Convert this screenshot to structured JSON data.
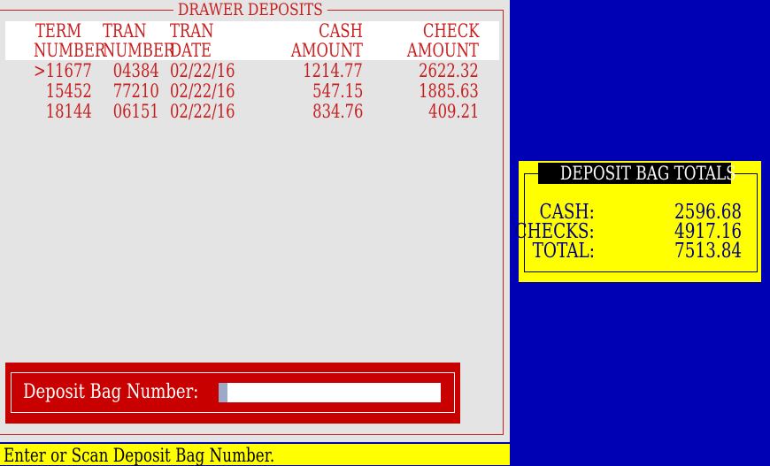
{
  "title": "DRAWER DEPOSITS",
  "columns": {
    "term": [
      "TERM",
      "NUMBER"
    ],
    "tran": [
      "TRAN",
      "NUMBER"
    ],
    "date": [
      "TRAN",
      "DATE"
    ],
    "cash": [
      "CASH",
      "AMOUNT"
    ],
    "check": [
      "CHECK",
      "AMOUNT"
    ]
  },
  "rows": [
    {
      "marker": ">",
      "term": "11677",
      "tran": "04384",
      "date": "02/22/16",
      "cash": "1214.77",
      "check": "2622.32"
    },
    {
      "marker": "",
      "term": "15452",
      "tran": "77210",
      "date": "02/22/16",
      "cash": "547.15",
      "check": "1885.63"
    },
    {
      "marker": "",
      "term": "18144",
      "tran": "06151",
      "date": "02/22/16",
      "cash": "834.76",
      "check": "409.21"
    }
  ],
  "bag": {
    "label": "Deposit Bag Number:",
    "value": ""
  },
  "status": "Enter or Scan Deposit Bag Number.",
  "totals": {
    "title": "DEPOSIT BAG TOTALS",
    "cash_label": "CASH:",
    "cash_value": "2596.68",
    "checks_label": "CHECKS:",
    "checks_value": "4917.16",
    "total_label": "TOTAL:",
    "total_value": "7513.84"
  },
  "colors": {
    "background": "#0000b4",
    "panel": "#e4e4e4",
    "text_red": "#c81e1e",
    "highlight_yellow": "#ffff00"
  }
}
